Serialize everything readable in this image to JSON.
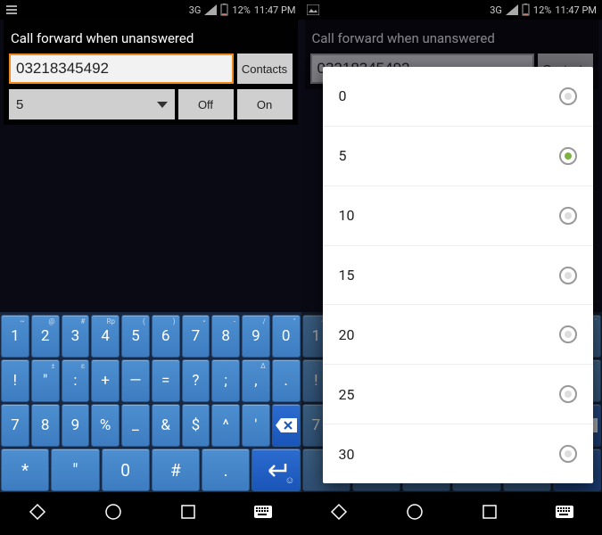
{
  "status": {
    "net": "3G",
    "battery_pct": "12%",
    "time": "11:47 PM"
  },
  "dialog": {
    "title": "Call forward when unanswered",
    "phone_value": "03218345492",
    "contacts_label": "Contacts",
    "dropdown_value": "5",
    "off_label": "Off",
    "on_label": "On"
  },
  "keyboard": {
    "row1": [
      {
        "k": "1",
        "s": "~"
      },
      {
        "k": "2",
        "s": "@"
      },
      {
        "k": "3",
        "s": "#"
      },
      {
        "k": "4",
        "s": "Rp"
      },
      {
        "k": "5",
        "s": "("
      },
      {
        "k": "6",
        "s": ")"
      },
      {
        "k": "7",
        "s": "•"
      },
      {
        "k": "8",
        "s": "-"
      },
      {
        "k": "9",
        "s": "/"
      },
      {
        "k": "0",
        "s": "\""
      }
    ],
    "row2": [
      {
        "k": "!",
        "s": ""
      },
      {
        "k": "\"",
        "s": "±"
      },
      {
        "k": ":",
        "s": "ε"
      },
      {
        "k": "+",
        "s": ""
      },
      {
        "k": "—",
        "s": ""
      },
      {
        "k": "=",
        "s": ""
      },
      {
        "k": "?",
        "s": ""
      },
      {
        "k": ";",
        "s": ""
      },
      {
        "k": ",",
        "s": "Δ"
      },
      {
        "k": ".",
        "s": ""
      }
    ],
    "row3_left": [
      {
        "k": "7"
      },
      {
        "k": "8"
      },
      {
        "k": "9"
      },
      {
        "k": "%"
      },
      {
        "k": "_"
      },
      {
        "k": "&"
      },
      {
        "k": "$"
      },
      {
        "k": "^"
      },
      {
        "k": "'"
      }
    ],
    "row4": [
      {
        "k": "*"
      },
      {
        "k": "\""
      },
      {
        "k": "0"
      },
      {
        "k": "#"
      },
      {
        "k": "."
      }
    ]
  },
  "dropdown_options": [
    {
      "label": "0",
      "selected": false
    },
    {
      "label": "5",
      "selected": true
    },
    {
      "label": "10",
      "selected": false
    },
    {
      "label": "15",
      "selected": false
    },
    {
      "label": "20",
      "selected": false
    },
    {
      "label": "25",
      "selected": false
    },
    {
      "label": "30",
      "selected": false
    }
  ]
}
